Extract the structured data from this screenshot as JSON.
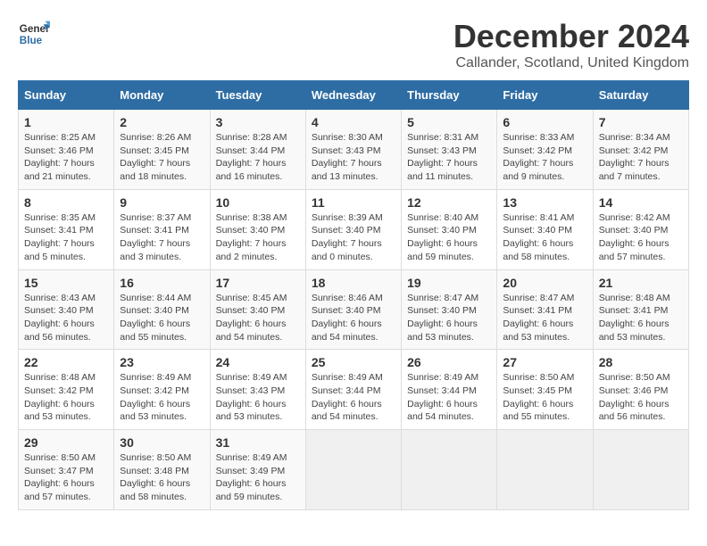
{
  "logo": {
    "line1": "General",
    "line2": "Blue"
  },
  "title": "December 2024",
  "location": "Callander, Scotland, United Kingdom",
  "headers": [
    "Sunday",
    "Monday",
    "Tuesday",
    "Wednesday",
    "Thursday",
    "Friday",
    "Saturday"
  ],
  "weeks": [
    [
      {
        "day": "1",
        "sunrise": "Sunrise: 8:25 AM",
        "sunset": "Sunset: 3:46 PM",
        "daylight": "Daylight: 7 hours and 21 minutes."
      },
      {
        "day": "2",
        "sunrise": "Sunrise: 8:26 AM",
        "sunset": "Sunset: 3:45 PM",
        "daylight": "Daylight: 7 hours and 18 minutes."
      },
      {
        "day": "3",
        "sunrise": "Sunrise: 8:28 AM",
        "sunset": "Sunset: 3:44 PM",
        "daylight": "Daylight: 7 hours and 16 minutes."
      },
      {
        "day": "4",
        "sunrise": "Sunrise: 8:30 AM",
        "sunset": "Sunset: 3:43 PM",
        "daylight": "Daylight: 7 hours and 13 minutes."
      },
      {
        "day": "5",
        "sunrise": "Sunrise: 8:31 AM",
        "sunset": "Sunset: 3:43 PM",
        "daylight": "Daylight: 7 hours and 11 minutes."
      },
      {
        "day": "6",
        "sunrise": "Sunrise: 8:33 AM",
        "sunset": "Sunset: 3:42 PM",
        "daylight": "Daylight: 7 hours and 9 minutes."
      },
      {
        "day": "7",
        "sunrise": "Sunrise: 8:34 AM",
        "sunset": "Sunset: 3:42 PM",
        "daylight": "Daylight: 7 hours and 7 minutes."
      }
    ],
    [
      {
        "day": "8",
        "sunrise": "Sunrise: 8:35 AM",
        "sunset": "Sunset: 3:41 PM",
        "daylight": "Daylight: 7 hours and 5 minutes."
      },
      {
        "day": "9",
        "sunrise": "Sunrise: 8:37 AM",
        "sunset": "Sunset: 3:41 PM",
        "daylight": "Daylight: 7 hours and 3 minutes."
      },
      {
        "day": "10",
        "sunrise": "Sunrise: 8:38 AM",
        "sunset": "Sunset: 3:40 PM",
        "daylight": "Daylight: 7 hours and 2 minutes."
      },
      {
        "day": "11",
        "sunrise": "Sunrise: 8:39 AM",
        "sunset": "Sunset: 3:40 PM",
        "daylight": "Daylight: 7 hours and 0 minutes."
      },
      {
        "day": "12",
        "sunrise": "Sunrise: 8:40 AM",
        "sunset": "Sunset: 3:40 PM",
        "daylight": "Daylight: 6 hours and 59 minutes."
      },
      {
        "day": "13",
        "sunrise": "Sunrise: 8:41 AM",
        "sunset": "Sunset: 3:40 PM",
        "daylight": "Daylight: 6 hours and 58 minutes."
      },
      {
        "day": "14",
        "sunrise": "Sunrise: 8:42 AM",
        "sunset": "Sunset: 3:40 PM",
        "daylight": "Daylight: 6 hours and 57 minutes."
      }
    ],
    [
      {
        "day": "15",
        "sunrise": "Sunrise: 8:43 AM",
        "sunset": "Sunset: 3:40 PM",
        "daylight": "Daylight: 6 hours and 56 minutes."
      },
      {
        "day": "16",
        "sunrise": "Sunrise: 8:44 AM",
        "sunset": "Sunset: 3:40 PM",
        "daylight": "Daylight: 6 hours and 55 minutes."
      },
      {
        "day": "17",
        "sunrise": "Sunrise: 8:45 AM",
        "sunset": "Sunset: 3:40 PM",
        "daylight": "Daylight: 6 hours and 54 minutes."
      },
      {
        "day": "18",
        "sunrise": "Sunrise: 8:46 AM",
        "sunset": "Sunset: 3:40 PM",
        "daylight": "Daylight: 6 hours and 54 minutes."
      },
      {
        "day": "19",
        "sunrise": "Sunrise: 8:47 AM",
        "sunset": "Sunset: 3:40 PM",
        "daylight": "Daylight: 6 hours and 53 minutes."
      },
      {
        "day": "20",
        "sunrise": "Sunrise: 8:47 AM",
        "sunset": "Sunset: 3:41 PM",
        "daylight": "Daylight: 6 hours and 53 minutes."
      },
      {
        "day": "21",
        "sunrise": "Sunrise: 8:48 AM",
        "sunset": "Sunset: 3:41 PM",
        "daylight": "Daylight: 6 hours and 53 minutes."
      }
    ],
    [
      {
        "day": "22",
        "sunrise": "Sunrise: 8:48 AM",
        "sunset": "Sunset: 3:42 PM",
        "daylight": "Daylight: 6 hours and 53 minutes."
      },
      {
        "day": "23",
        "sunrise": "Sunrise: 8:49 AM",
        "sunset": "Sunset: 3:42 PM",
        "daylight": "Daylight: 6 hours and 53 minutes."
      },
      {
        "day": "24",
        "sunrise": "Sunrise: 8:49 AM",
        "sunset": "Sunset: 3:43 PM",
        "daylight": "Daylight: 6 hours and 53 minutes."
      },
      {
        "day": "25",
        "sunrise": "Sunrise: 8:49 AM",
        "sunset": "Sunset: 3:44 PM",
        "daylight": "Daylight: 6 hours and 54 minutes."
      },
      {
        "day": "26",
        "sunrise": "Sunrise: 8:49 AM",
        "sunset": "Sunset: 3:44 PM",
        "daylight": "Daylight: 6 hours and 54 minutes."
      },
      {
        "day": "27",
        "sunrise": "Sunrise: 8:50 AM",
        "sunset": "Sunset: 3:45 PM",
        "daylight": "Daylight: 6 hours and 55 minutes."
      },
      {
        "day": "28",
        "sunrise": "Sunrise: 8:50 AM",
        "sunset": "Sunset: 3:46 PM",
        "daylight": "Daylight: 6 hours and 56 minutes."
      }
    ],
    [
      {
        "day": "29",
        "sunrise": "Sunrise: 8:50 AM",
        "sunset": "Sunset: 3:47 PM",
        "daylight": "Daylight: 6 hours and 57 minutes."
      },
      {
        "day": "30",
        "sunrise": "Sunrise: 8:50 AM",
        "sunset": "Sunset: 3:48 PM",
        "daylight": "Daylight: 6 hours and 58 minutes."
      },
      {
        "day": "31",
        "sunrise": "Sunrise: 8:49 AM",
        "sunset": "Sunset: 3:49 PM",
        "daylight": "Daylight: 6 hours and 59 minutes."
      },
      null,
      null,
      null,
      null
    ]
  ]
}
